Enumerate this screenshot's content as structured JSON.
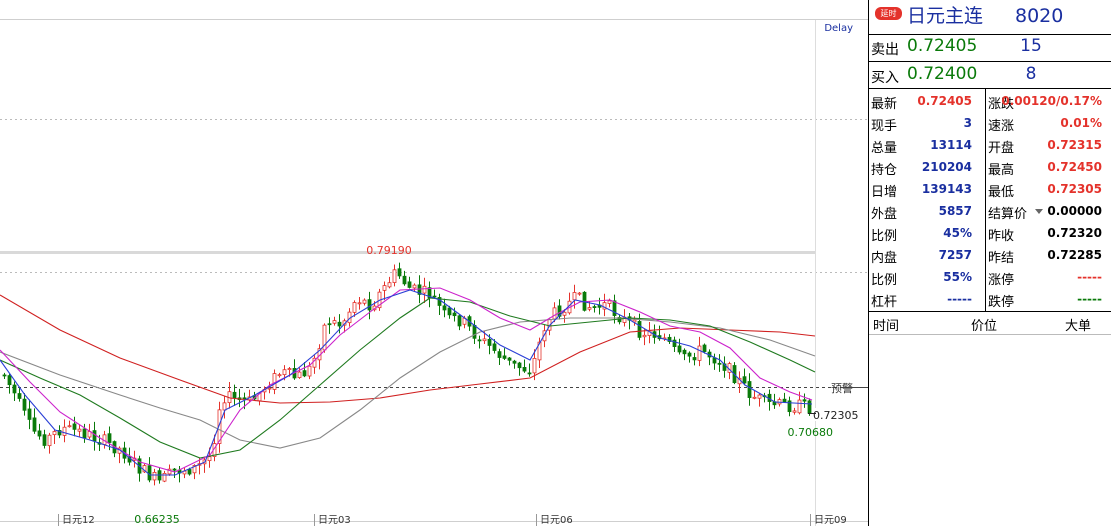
{
  "chart": {
    "delay_label": "Delay",
    "warn_label": "预警",
    "price_right_label": "0.72305",
    "low_label": "0.70680",
    "high_label": "0.79190",
    "low_marker_label": "0.66235",
    "x_labels": [
      "日元12",
      "日元03",
      "日元06",
      "日元09"
    ],
    "colors": {
      "up": "#e4322b",
      "down": "#0a7a0a",
      "bg": "#ffffff",
      "ma_red": "#d02020",
      "ma_gray": "#888888",
      "ma_green": "#1f7a1f",
      "ma_magenta": "#cc22cc",
      "ma_blue": "#2a3fd6"
    }
  },
  "panel": {
    "badge": "延时",
    "title": "日元主连",
    "code": "8020",
    "sell_label": "卖出",
    "sell_price": "0.72405",
    "sell_vol": "15",
    "buy_label": "买入",
    "buy_price": "0.72400",
    "buy_vol": "8",
    "stats": [
      {
        "l": "最新",
        "v": "0.72405",
        "vc": "#e4322b",
        "l2": "涨跌",
        "v2": "0.00120/0.17%",
        "v2c": "#e4322b"
      },
      {
        "l": "现手",
        "v": "3",
        "vc": "#1a2fa0",
        "l2": "速涨",
        "v2": "0.01%",
        "v2c": "#e4322b"
      },
      {
        "l": "总量",
        "v": "13114",
        "vc": "#1a2fa0",
        "l2": "开盘",
        "v2": "0.72315",
        "v2c": "#e4322b"
      },
      {
        "l": "持仓",
        "v": "210204",
        "vc": "#1a2fa0",
        "l2": "最高",
        "v2": "0.72450",
        "v2c": "#e4322b"
      },
      {
        "l": "日增",
        "v": "139143",
        "vc": "#1a2fa0",
        "l2": "最低",
        "v2": "0.72305",
        "v2c": "#e4322b"
      },
      {
        "l": "外盘",
        "v": "5857",
        "vc": "#1a2fa0",
        "l2": "结算价",
        "v2": "0.00000",
        "v2c": "#000000"
      },
      {
        "l": "比例",
        "v": "45%",
        "vc": "#1a2fa0",
        "l2": "昨收",
        "v2": "0.72320",
        "v2c": "#000000"
      },
      {
        "l": "内盘",
        "v": "7257",
        "vc": "#1a2fa0",
        "l2": "昨结",
        "v2": "0.72285",
        "v2c": "#000000"
      },
      {
        "l": "比例",
        "v": "55%",
        "vc": "#1a2fa0",
        "l2": "涨停",
        "v2": "-----",
        "v2c": "#e4322b"
      },
      {
        "l": "杠杆",
        "v": "-----",
        "vc": "#1a2fa0",
        "l2": "跌停",
        "v2": "-----",
        "v2c": "#0a7a0a"
      }
    ],
    "tick_headers": [
      "时间",
      "价位",
      "大单"
    ]
  }
}
